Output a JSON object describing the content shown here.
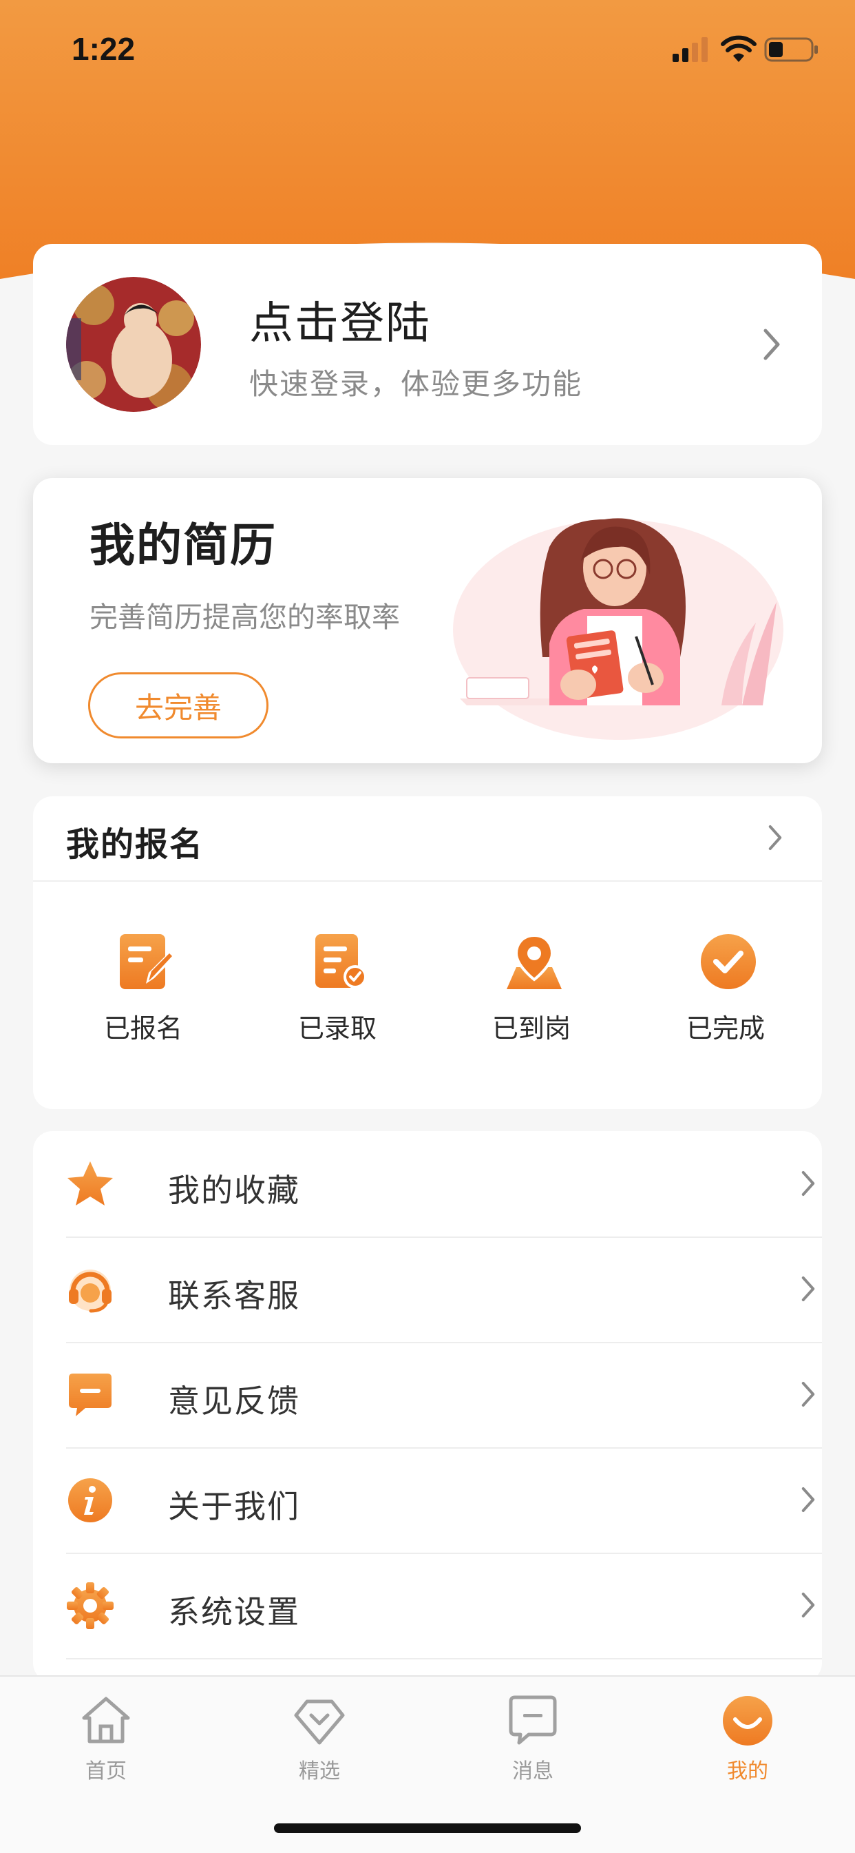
{
  "status_bar": {
    "time": "1:22"
  },
  "login": {
    "title": "点击登陆",
    "subtitle": "快速登录，体验更多功能"
  },
  "resume": {
    "title": "我的简历",
    "subtitle": "完善简历提高您的率取率",
    "button": "去完善"
  },
  "signup": {
    "title": "我的报名",
    "items": [
      {
        "label": "已报名",
        "icon": "signed-up-icon"
      },
      {
        "label": "已录取",
        "icon": "admitted-icon"
      },
      {
        "label": "已到岗",
        "icon": "arrived-icon"
      },
      {
        "label": "已完成",
        "icon": "completed-icon"
      }
    ]
  },
  "menu": {
    "items": [
      {
        "label": "我的收藏",
        "icon": "star-icon"
      },
      {
        "label": "联系客服",
        "icon": "headset-icon"
      },
      {
        "label": "意见反馈",
        "icon": "feedback-icon"
      },
      {
        "label": "关于我们",
        "icon": "info-icon"
      },
      {
        "label": "系统设置",
        "icon": "gear-icon"
      }
    ]
  },
  "tabs": [
    {
      "label": "首页",
      "icon": "home-icon"
    },
    {
      "label": "精选",
      "icon": "diamond-icon"
    },
    {
      "label": "消息",
      "icon": "message-icon"
    },
    {
      "label": "我的",
      "icon": "profile-icon",
      "active": true
    }
  ],
  "colors": {
    "accent": "#f08a2e",
    "header_top": "#f3963a",
    "header_bottom": "#ef8228"
  }
}
